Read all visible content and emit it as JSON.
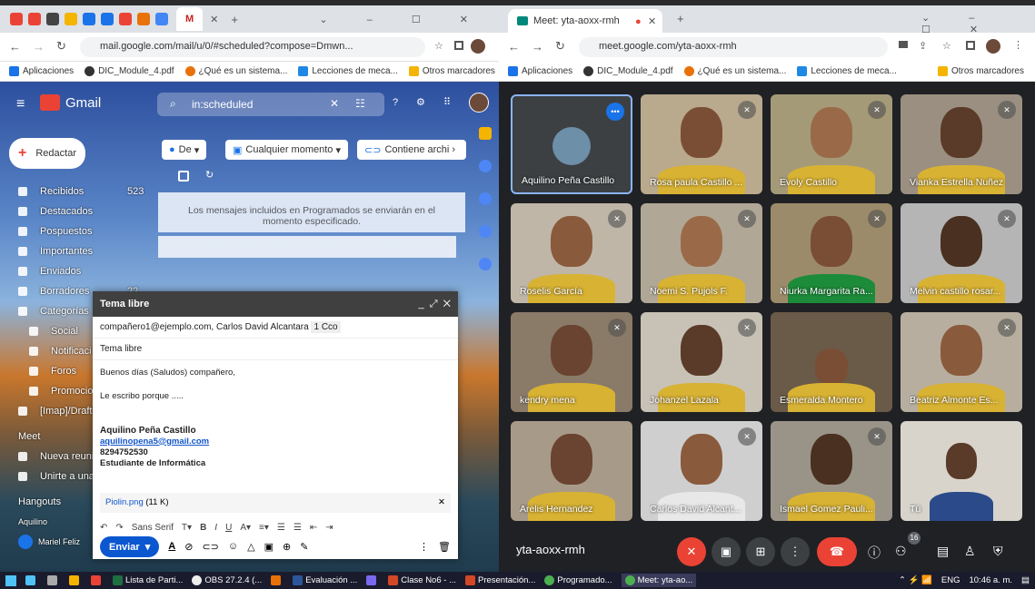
{
  "left_browser": {
    "tab_active": "M",
    "url": "mail.google.com/mail/u/0/#scheduled?compose=Dmwn...",
    "bookmarks": [
      "Aplicaciones",
      "DIC_Module_4.pdf",
      "¿Qué es un sistema...",
      "Lecciones de meca...",
      "Otros marcadores"
    ]
  },
  "gmail": {
    "logo": "Gmail",
    "search_value": "in:scheduled",
    "compose_button": "Redactar",
    "filters": [
      "De",
      "Cualquier momento",
      "Contiene archi"
    ],
    "nav": [
      {
        "label": "Recibidos",
        "count": "523"
      },
      {
        "label": "Destacados",
        "count": ""
      },
      {
        "label": "Pospuestos",
        "count": ""
      },
      {
        "label": "Importantes",
        "count": ""
      },
      {
        "label": "Enviados",
        "count": ""
      },
      {
        "label": "Borradores",
        "count": "22"
      },
      {
        "label": "Categorías",
        "count": ""
      },
      {
        "label": "Social",
        "count": ""
      },
      {
        "label": "Notificaci",
        "count": ""
      },
      {
        "label": "Foros",
        "count": ""
      },
      {
        "label": "Promocior",
        "count": ""
      },
      {
        "label": "[Imap]/Draft",
        "count": ""
      }
    ],
    "meet_section": "Meet",
    "meet_items": [
      "Nueva reuni",
      "Unirte a una"
    ],
    "hangouts_section": "Hangouts",
    "hangouts_user": "Aquilino",
    "hangouts_user2": "Mariel Feliz",
    "notice": "Los mensajes incluidos en Programados se enviarán en el momento especificado."
  },
  "compose": {
    "title": "Tema libre",
    "to": "compañero1@ejemplo.com, Carlos David Alcantara",
    "cco": "1 Cco",
    "subject": "Tema libre",
    "body_line1": "Buenos días (Saludos) compañero,",
    "body_line2": "Le escribo porque .....",
    "sig_name": "Aquilino Peña Castillo",
    "sig_email": "aquilinopena5@gmail.com",
    "sig_phone": "8294752530",
    "sig_role": "Estudiante de Informática",
    "attachment": "Piolin.png",
    "attachment_size": "(11 K)",
    "font": "Sans Serif",
    "send": "Enviar"
  },
  "right_browser": {
    "tab_title": "Meet: yta-aoxx-rmh",
    "url": "meet.google.com/yta-aoxx-rmh",
    "bookmarks": [
      "Aplicaciones",
      "DIC_Module_4.pdf",
      "¿Qué es un sistema...",
      "Lecciones de meca...",
      "Otros marcadores"
    ]
  },
  "meet": {
    "code": "yta-aoxx-rmh",
    "participants_count": "16",
    "participants": [
      "Aquilino Peña Castillo",
      "Rosa paula Castillo ...",
      "Evoly Castillo",
      "Vianka Estrella Nuñez",
      "Roselis García",
      "Noemi S. Pujols F.",
      "Niurka Margarita Ra...",
      "Melvin castillo rosar...",
      "kendry mena",
      "Johanzel Lazala",
      "Esmeralda Montero",
      "Beatriz Almonte Es...",
      "Arelis Hernandez",
      "Carlos David Alcant...",
      "Ismael Gomez Pauli...",
      "Tú"
    ]
  },
  "taskbar": {
    "items": [
      "Lista de Parti...",
      "OBS 27.2.4 (...",
      "Evaluación ...",
      "Clase No6 - ...",
      "Presentación...",
      "Programado...",
      "Meet: yta-ao..."
    ],
    "lang": "ENG",
    "time": "10:46 a. m."
  }
}
